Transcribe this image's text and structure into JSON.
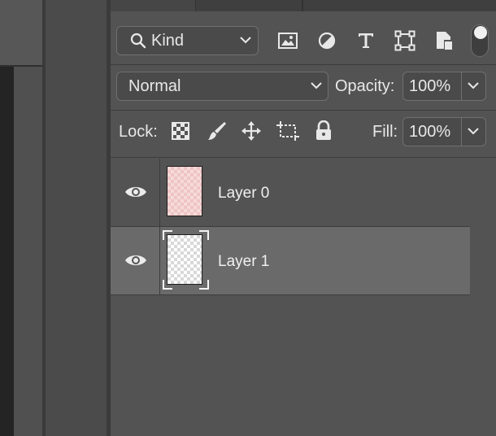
{
  "colors": {
    "panel_bg": "#535353",
    "selected_row_bg": "#6a6a6a",
    "text": "#e6e6e6"
  },
  "filter": {
    "kind_label": "Kind",
    "icons": [
      "search-icon",
      "pixel-layer-filter-icon",
      "adjustment-layer-filter-icon",
      "type-layer-filter-icon",
      "shape-layer-filter-icon",
      "smart-object-filter-icon",
      "filter-toggle-icon"
    ]
  },
  "blend": {
    "mode": "Normal",
    "opacity_label": "Opacity:",
    "opacity_value": "100%"
  },
  "lock": {
    "label": "Lock:",
    "icons": [
      "lock-transparent-pixels-icon",
      "lock-image-pixels-icon",
      "lock-position-icon",
      "lock-artboard-icon",
      "lock-all-icon"
    ],
    "fill_label": "Fill:",
    "fill_value": "100%"
  },
  "layers": [
    {
      "name": "Layer 0",
      "visible": true,
      "selected": false
    },
    {
      "name": "Layer 1",
      "visible": true,
      "selected": true
    }
  ]
}
